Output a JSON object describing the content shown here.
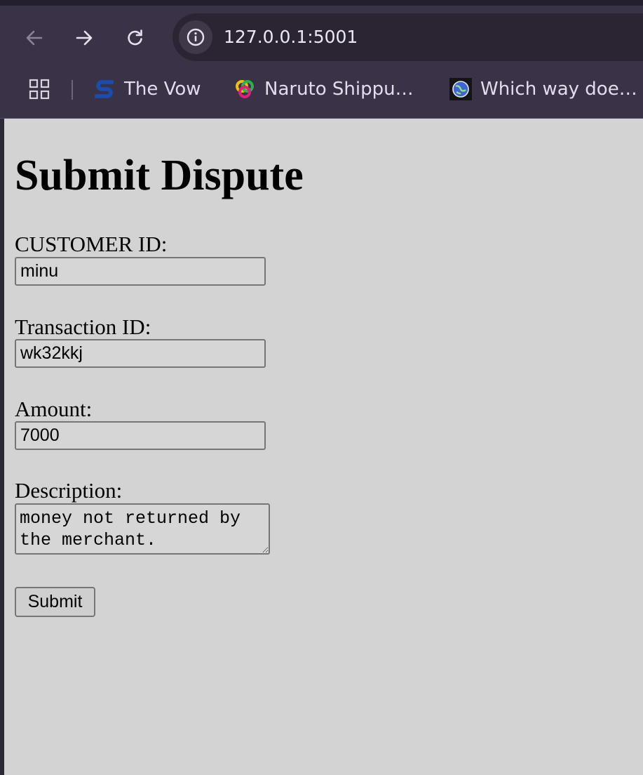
{
  "browser": {
    "url": "127.0.0.1:5001",
    "bookmarks": [
      {
        "label": "The Vow",
        "icon": "streaming-s-icon"
      },
      {
        "label": "Naruto Shippu…",
        "icon": "anime-site-icon"
      },
      {
        "label": "Which way doe…",
        "icon": "globe-site-icon"
      }
    ]
  },
  "page": {
    "title": "Submit Dispute",
    "fields": {
      "customer_id": {
        "label": "CUSTOMER ID:",
        "value": "minu"
      },
      "transaction_id": {
        "label": "Transaction ID:",
        "value": "wk32kkj"
      },
      "amount": {
        "label": "Amount:",
        "value": "7000"
      },
      "description": {
        "label": "Description:",
        "value": "money not returned by the merchant."
      }
    },
    "submit_label": "Submit"
  },
  "colors": {
    "page_background": "#d3d3d3",
    "browser_chrome": "#3a3347",
    "omnibox": "#2a2433"
  }
}
